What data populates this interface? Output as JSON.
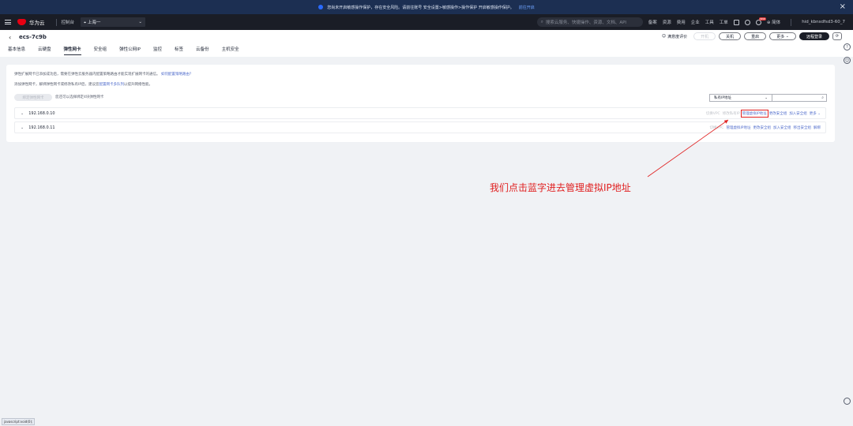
{
  "notice": {
    "text": "您尚未开启敏感操作保护，存在安全风险。请前往账号 安全设置>敏感操作>操作保护 开启敏感操作保护。",
    "link": "前往开启",
    "close_icon": "close-icon"
  },
  "topbar": {
    "brand": "华为云",
    "console": "控制台",
    "region": "上海一",
    "search_placeholder": "搜索云服务、快捷操作、资源、文档、API",
    "links": [
      "备案",
      "资源",
      "费用",
      "企业",
      "工具",
      "工单"
    ],
    "lang": "简体",
    "user": "hid_kbnsdfsd3-60_7",
    "hot_badge": "new"
  },
  "header": {
    "title": "ecs-7c9b",
    "feedback": "满意度评价",
    "buttons": {
      "start": "开机",
      "shutdown": "关机",
      "restart": "重启",
      "more": "更多",
      "remote": "远程登录"
    }
  },
  "tabs": [
    "基本信息",
    "云硬盘",
    "弹性网卡",
    "安全组",
    "弹性公网IP",
    "监控",
    "标签",
    "云备份",
    "主机安全"
  ],
  "active_tab_index": 2,
  "panel": {
    "info1": "弹性扩展网卡已添加成功后，需要在弹性云服务器内配置策略路由才能实现扩展网卡的通信。",
    "info1_link": "如何配置策略路由？",
    "info2_prefix": "添加弹性网卡，解绑弹性网卡或修改私有IP后，建议您",
    "info2_link": "配置网卡多队列",
    "info2_suffix": "以提升网络性能。",
    "bind_button": "绑定弹性网卡",
    "bind_tip": "您还可以选择绑定4块弹性网卡",
    "filter_select": "私有IP地址"
  },
  "nics": [
    {
      "ip": "192.168.0.10",
      "ops": [
        {
          "label": "切换VPC",
          "disabled": true
        },
        {
          "label": "修改私有IP",
          "disabled": true
        },
        {
          "label": "管理虚拟IP地址",
          "disabled": false,
          "highlighted": true
        },
        {
          "label": "更改安全组",
          "disabled": false
        },
        {
          "label": "加入安全组",
          "disabled": false
        },
        {
          "label": "更多",
          "disabled": false
        }
      ]
    },
    {
      "ip": "192.168.0.11",
      "ops": [
        {
          "label": "切换VPC",
          "disabled": true
        },
        {
          "label": "管理虚拟IP地址",
          "disabled": false
        },
        {
          "label": "更改安全组",
          "disabled": false
        },
        {
          "label": "加入安全组",
          "disabled": false
        },
        {
          "label": "移出安全组",
          "disabled": false
        },
        {
          "label": "解绑",
          "disabled": false
        }
      ]
    }
  ],
  "annotation": "我们点击蓝字进去管理虚拟IP地址",
  "colors": {
    "link": "#526ecc",
    "annotation": "#e02020",
    "topbar": "#1a1d26"
  },
  "statusbar": "javascript:void(0);"
}
